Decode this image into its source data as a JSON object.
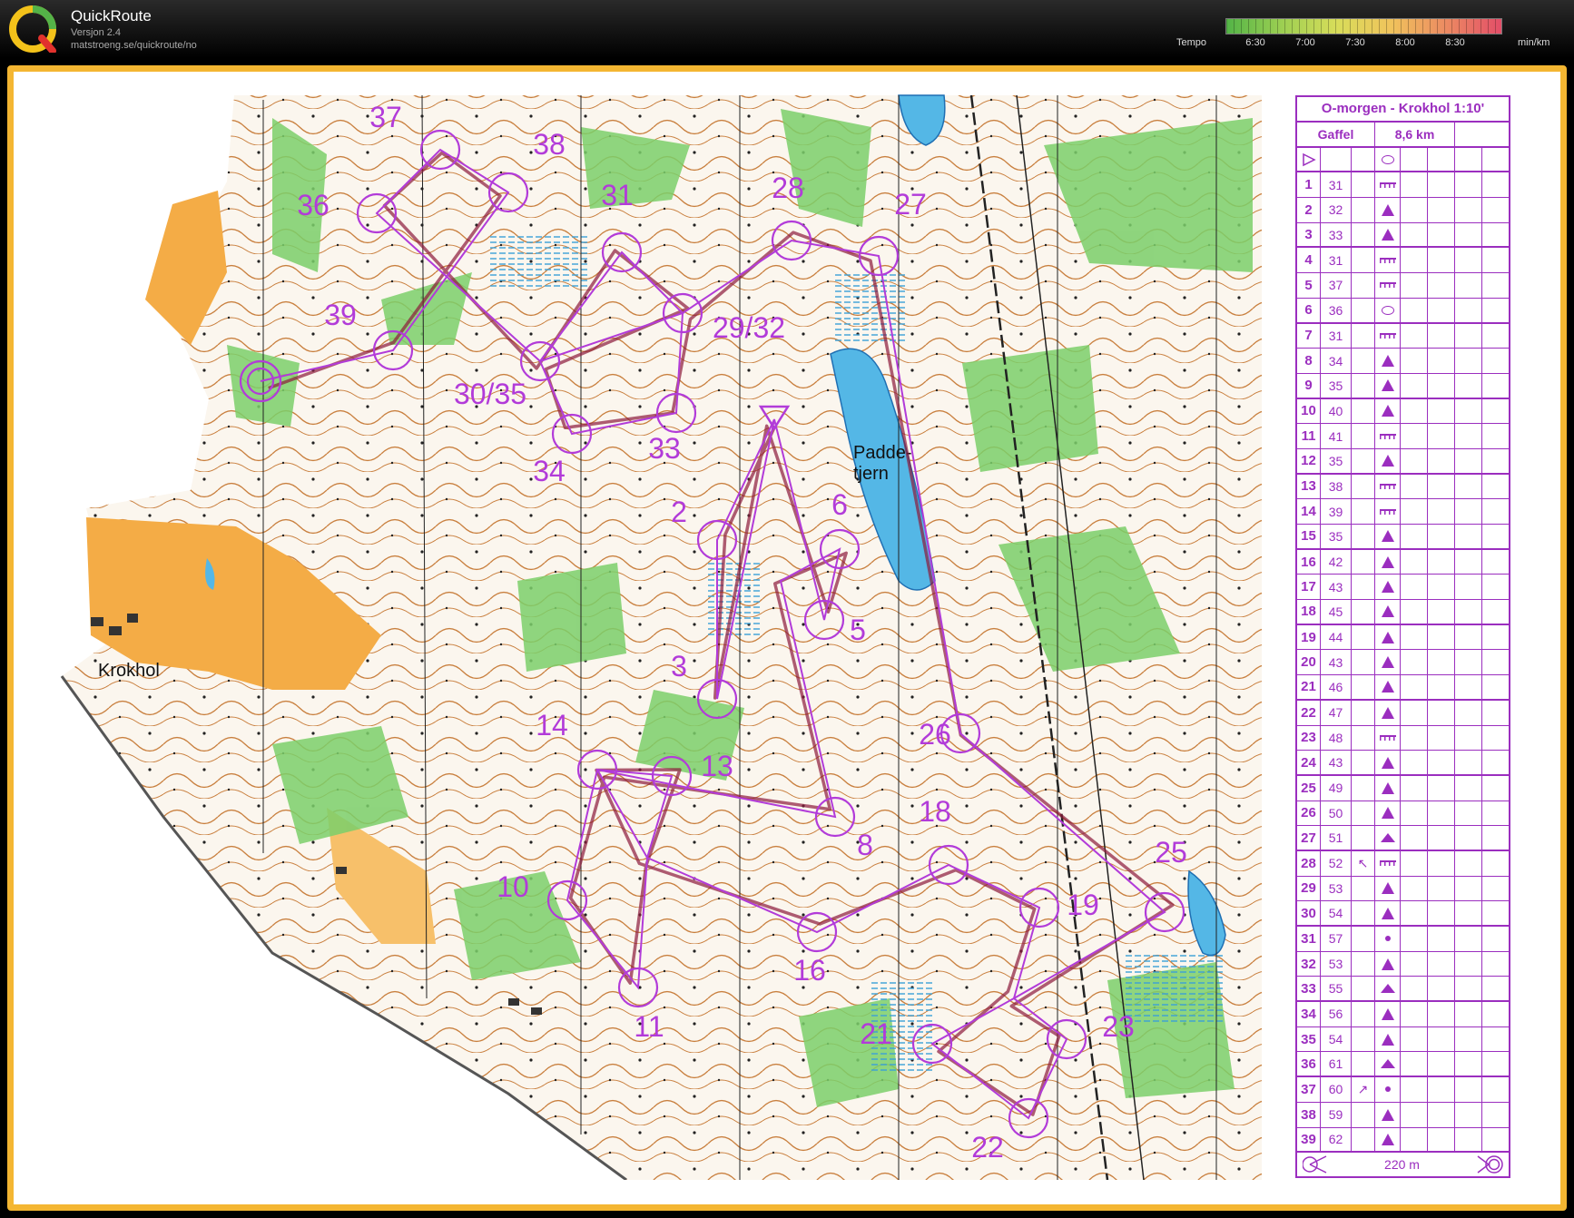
{
  "app": {
    "title": "QuickRoute",
    "version": "Versjon 2.4",
    "url": "matstroeng.se/quickroute/no",
    "logo_letter": "Q"
  },
  "tempo": {
    "label": "Tempo",
    "ticks": [
      "6:30",
      "7:00",
      "7:30",
      "8:00",
      "8:30"
    ],
    "unit": "min/km",
    "colors": [
      "#53b447",
      "#9ccf52",
      "#d8dd5a",
      "#f0c35c",
      "#ec8a62",
      "#e34e68"
    ]
  },
  "map": {
    "place_labels": [
      "Krokhol",
      "Padde-",
      "tjern"
    ],
    "course_color": "#b23bd9",
    "route_color": "#8b1a3a",
    "controls": [
      {
        "label": "37"
      },
      {
        "label": "38"
      },
      {
        "label": "36"
      },
      {
        "label": "31"
      },
      {
        "label": "28"
      },
      {
        "label": "27"
      },
      {
        "label": "39"
      },
      {
        "label": "29/32"
      },
      {
        "label": "30/35"
      },
      {
        "label": "33"
      },
      {
        "label": "34"
      },
      {
        "label": "2"
      },
      {
        "label": "6"
      },
      {
        "label": "5"
      },
      {
        "label": "3"
      },
      {
        "label": "14"
      },
      {
        "label": "13"
      },
      {
        "label": "26"
      },
      {
        "label": "18"
      },
      {
        "label": "8"
      },
      {
        "label": "25"
      },
      {
        "label": "10"
      },
      {
        "label": "19"
      },
      {
        "label": "16"
      },
      {
        "label": "11"
      },
      {
        "label": "21"
      },
      {
        "label": "23"
      },
      {
        "label": "22"
      }
    ]
  },
  "description_sheet": {
    "title": "O-morgen - Krokhol 1:10'",
    "gaffel_label": "Gaffel",
    "distance": "8,6 km",
    "scale_text": "220 m",
    "controls": [
      {
        "num": "1",
        "code": "31",
        "sym": "ditch"
      },
      {
        "num": "2",
        "code": "32",
        "sym": "knoll"
      },
      {
        "num": "3",
        "code": "33",
        "sym": "knoll"
      },
      {
        "num": "4",
        "code": "31",
        "sym": "ditch"
      },
      {
        "num": "5",
        "code": "37",
        "sym": "ditch"
      },
      {
        "num": "6",
        "code": "36",
        "sym": "oval"
      },
      {
        "num": "7",
        "code": "31",
        "sym": "ditch"
      },
      {
        "num": "8",
        "code": "34",
        "sym": "knoll"
      },
      {
        "num": "9",
        "code": "35",
        "sym": "knoll"
      },
      {
        "num": "10",
        "code": "40",
        "sym": "knoll"
      },
      {
        "num": "11",
        "code": "41",
        "sym": "ditch"
      },
      {
        "num": "12",
        "code": "35",
        "sym": "knoll"
      },
      {
        "num": "13",
        "code": "38",
        "sym": "ditch"
      },
      {
        "num": "14",
        "code": "39",
        "sym": "ditch"
      },
      {
        "num": "15",
        "code": "35",
        "sym": "knoll"
      },
      {
        "num": "16",
        "code": "42",
        "sym": "knoll"
      },
      {
        "num": "17",
        "code": "43",
        "sym": "knoll"
      },
      {
        "num": "18",
        "code": "45",
        "sym": "knoll"
      },
      {
        "num": "19",
        "code": "44",
        "sym": "knoll"
      },
      {
        "num": "20",
        "code": "43",
        "sym": "knoll"
      },
      {
        "num": "21",
        "code": "46",
        "sym": "knoll"
      },
      {
        "num": "22",
        "code": "47",
        "sym": "knoll"
      },
      {
        "num": "23",
        "code": "48",
        "sym": "ditch"
      },
      {
        "num": "24",
        "code": "43",
        "sym": "knoll"
      },
      {
        "num": "25",
        "code": "49",
        "sym": "knoll"
      },
      {
        "num": "26",
        "code": "50",
        "sym": "knoll"
      },
      {
        "num": "27",
        "code": "51",
        "sym": "knoll2"
      },
      {
        "num": "28",
        "code": "52",
        "sym": "ditch",
        "dir": "↖"
      },
      {
        "num": "29",
        "code": "53",
        "sym": "knoll"
      },
      {
        "num": "30",
        "code": "54",
        "sym": "knoll"
      },
      {
        "num": "31",
        "code": "57",
        "sym": "dot"
      },
      {
        "num": "32",
        "code": "53",
        "sym": "knoll"
      },
      {
        "num": "33",
        "code": "55",
        "sym": "knoll2"
      },
      {
        "num": "34",
        "code": "56",
        "sym": "knoll"
      },
      {
        "num": "35",
        "code": "54",
        "sym": "knoll"
      },
      {
        "num": "36",
        "code": "61",
        "sym": "knoll2"
      },
      {
        "num": "37",
        "code": "60",
        "sym": "dot",
        "dir": "↗"
      },
      {
        "num": "38",
        "code": "59",
        "sym": "knoll"
      },
      {
        "num": "39",
        "code": "62",
        "sym": "knoll"
      }
    ]
  }
}
